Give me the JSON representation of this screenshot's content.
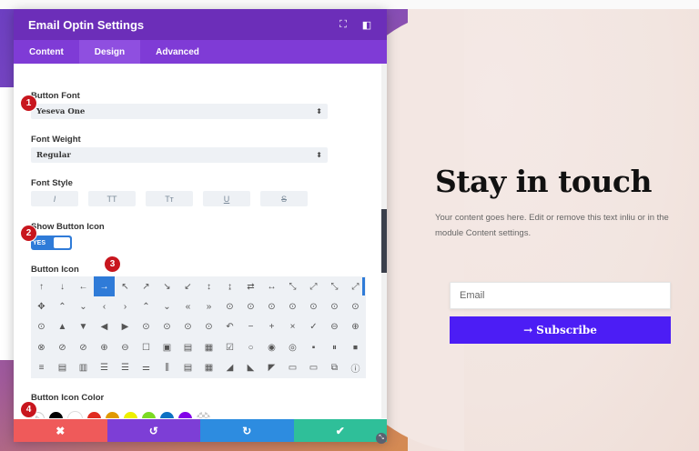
{
  "panel": {
    "title": "Email Optin Settings",
    "header_icons": [
      "expand-icon",
      "sidebar-toggle-icon"
    ],
    "tabs": [
      {
        "label": "Content",
        "active": false
      },
      {
        "label": "Design",
        "active": true
      },
      {
        "label": "Advanced",
        "active": false
      }
    ],
    "button_font": {
      "label": "Button Font",
      "value": "Yeseva One"
    },
    "font_weight": {
      "label": "Font Weight",
      "value": "Regular"
    },
    "font_style": {
      "label": "Font Style",
      "options": [
        "I",
        "TT",
        "Tт",
        "U",
        "S"
      ]
    },
    "show_icon": {
      "label": "Show Button Icon",
      "toggle_text": "YES",
      "enabled": true
    },
    "button_icon": {
      "label": "Button Icon",
      "selected_index": 3,
      "icons": [
        "↑",
        "↓",
        "←",
        "→",
        "↖",
        "↗",
        "↘",
        "↙",
        "↕",
        "↨",
        "⇄",
        "↔",
        "⤡",
        "⤢",
        "⤡",
        "⤢",
        "✥",
        "⌃",
        "⌄",
        "‹",
        "›",
        "⌃",
        "⌄",
        "«",
        "»",
        "⊙",
        "⊙",
        "⊙",
        "⊙",
        "⊙",
        "⊙",
        "⊙",
        "⊙",
        "▲",
        "▼",
        "◀",
        "▶",
        "⊙",
        "⊙",
        "⊙",
        "⊙",
        "↶",
        "−",
        "+",
        "×",
        "✓",
        "⊖",
        "⊕",
        "⊗",
        "⊘",
        "⊘",
        "⊕",
        "⊖",
        "☐",
        "▣",
        "▤",
        "▦",
        "☑",
        "○",
        "◉",
        "◎",
        "▪",
        "⏸",
        "⏹",
        "≡",
        "▤",
        "▥",
        "☰",
        "☰",
        "⚌",
        "⫼",
        "▤",
        "▦",
        "◢",
        "◣",
        "◤",
        "▭",
        "▭",
        "⧉",
        "ⓘ"
      ]
    },
    "icon_color": {
      "label": "Button Icon Color",
      "swatches": [
        "#ffffff",
        "#000000",
        "#ffffff",
        "#e02b20",
        "#e09900",
        "#edf000",
        "#7cda24",
        "#0c71c3",
        "#8300e9"
      ]
    },
    "footer": {
      "cancel": "✖",
      "undo": "↺",
      "redo": "↻",
      "save": "✔"
    }
  },
  "hero": {
    "title": "Stay in touch",
    "text": "Your content goes here. Edit or remove this text inliu or in the module Content settings.",
    "email_placeholder": "Email",
    "subscribe_label": "Subscribe",
    "subscribe_icon": "→"
  },
  "badges": [
    "1",
    "2",
    "3",
    "4"
  ],
  "colors": {
    "accent": "#6c2eb9",
    "button": "#4c1df5",
    "toggle": "#2f7bd8",
    "badge": "#c8161e"
  }
}
